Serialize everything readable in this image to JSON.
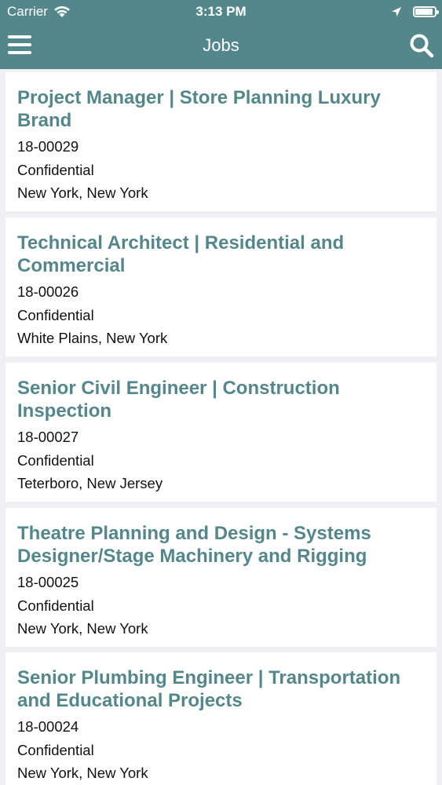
{
  "status_bar": {
    "carrier": "Carrier",
    "time": "3:13 PM"
  },
  "nav": {
    "title": "Jobs",
    "menu_icon": "hamburger-menu-icon",
    "search_icon": "search-icon"
  },
  "colors": {
    "header": "#53878b",
    "title_text": "#53878b",
    "background": "#efeff4"
  },
  "jobs": [
    {
      "title": "Project Manager | Store Planning Luxury Brand",
      "id": "18-00029",
      "company": "Confidential",
      "location": "New York, New York"
    },
    {
      "title": "Technical Architect | Residential and Commercial",
      "id": "18-00026",
      "company": "Confidential",
      "location": "White Plains, New York"
    },
    {
      "title": "Senior Civil Engineer | Construction Inspection",
      "id": "18-00027",
      "company": "Confidential",
      "location": "Teterboro, New Jersey"
    },
    {
      "title": "Theatre Planning and Design - Systems Designer/Stage Machinery and Rigging",
      "id": "18-00025",
      "company": "Confidential",
      "location": "New York, New York"
    },
    {
      "title": "Senior Plumbing Engineer | Transportation and Educational Projects",
      "id": "18-00024",
      "company": "Confidential",
      "location": "New York, New York"
    }
  ]
}
